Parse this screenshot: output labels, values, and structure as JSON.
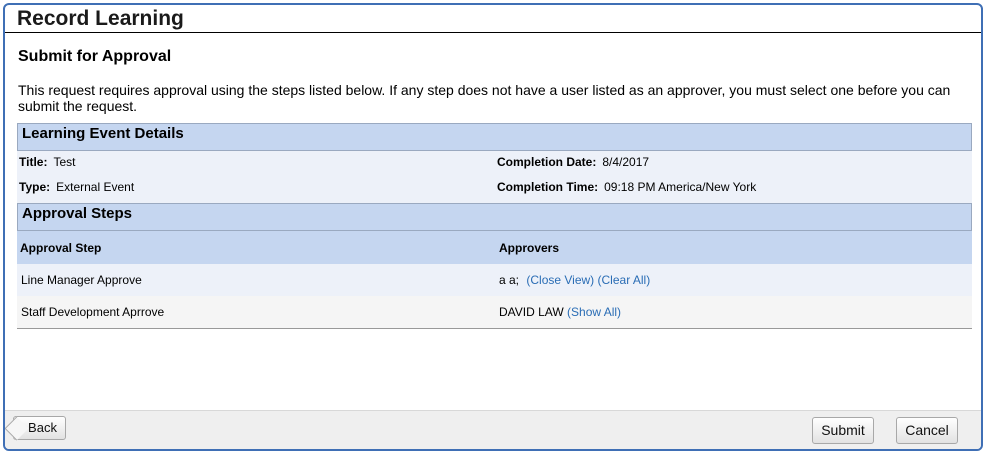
{
  "title": "Record Learning",
  "subtitle": "Submit for Approval",
  "intro": "This request requires approval using the steps listed below. If any step does not have a user listed as an approver, you must select one before you can submit the request.",
  "event": {
    "header": "Learning Event Details",
    "title_label": "Title:",
    "title_value": "Test",
    "type_label": "Type:",
    "type_value": "External Event",
    "date_label": "Completion Date:",
    "date_value": "8/4/2017",
    "time_label": "Completion Time:",
    "time_value": "09:18 PM America/New York"
  },
  "approval": {
    "header": "Approval Steps",
    "col_step": "Approval Step",
    "col_approvers": "Approvers",
    "rows": [
      {
        "step": "Line Manager Approve",
        "approver": "a a;",
        "links": [
          "(Close View)",
          "(Clear All)"
        ]
      },
      {
        "step": "Staff Development Aprrove",
        "approver": "DAVID LAW",
        "links": [
          "(Show All)"
        ]
      }
    ]
  },
  "footer": {
    "back": "Back",
    "submit": "Submit",
    "cancel": "Cancel"
  }
}
